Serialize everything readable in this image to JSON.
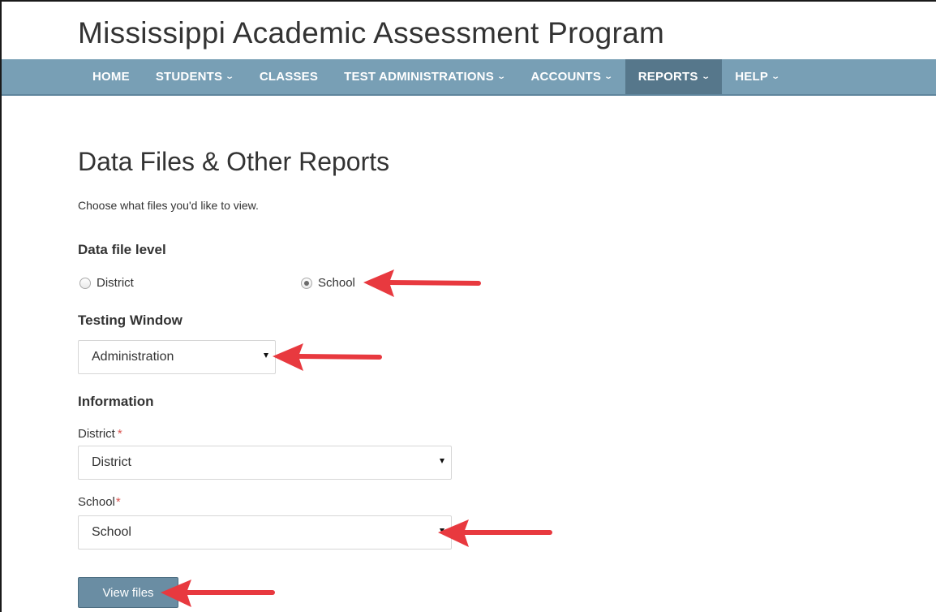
{
  "site": {
    "title": "Mississippi Academic Assessment Program"
  },
  "nav": {
    "items": [
      {
        "label": "HOME",
        "dropdown": false,
        "active": false
      },
      {
        "label": "STUDENTS",
        "dropdown": true,
        "active": false
      },
      {
        "label": "CLASSES",
        "dropdown": false,
        "active": false
      },
      {
        "label": "TEST ADMINISTRATIONS",
        "dropdown": true,
        "active": false
      },
      {
        "label": "ACCOUNTS",
        "dropdown": true,
        "active": false
      },
      {
        "label": "REPORTS",
        "dropdown": true,
        "active": true
      },
      {
        "label": "HELP",
        "dropdown": true,
        "active": false
      }
    ]
  },
  "page": {
    "heading": "Data Files & Other Reports",
    "intro": "Choose what files you'd like to view."
  },
  "data_file_level": {
    "label": "Data file level",
    "options": [
      {
        "label": "District",
        "checked": false
      },
      {
        "label": "School",
        "checked": true
      }
    ]
  },
  "testing_window": {
    "label": "Testing Window",
    "selected": "Administration"
  },
  "information": {
    "label": "Information",
    "district": {
      "label": "District",
      "required_mark": "*",
      "selected": "District"
    },
    "school": {
      "label": "School",
      "required_mark": "*",
      "selected": "School"
    }
  },
  "actions": {
    "view_files_label": "View files"
  },
  "colors": {
    "navbar": "#789fb5",
    "nav_active": "#56778b",
    "button": "#6a8da3",
    "required": "#d9534f",
    "annotation_arrow": "#e8393f"
  }
}
